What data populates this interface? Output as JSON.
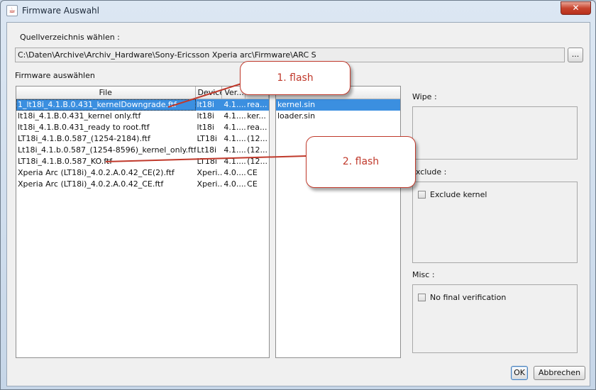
{
  "window": {
    "title": "Firmware Auswahl",
    "close_glyph": "✕",
    "app_icon": "java-icon"
  },
  "source": {
    "label": "Quellverzeichnis wählen :",
    "path": "C:\\Daten\\Archive\\Archiv_Hardware\\Sony-Ericsson Xperia arc\\Firmware\\ARC S",
    "browse_label": "..."
  },
  "firmware": {
    "label": "Firmware auswählen",
    "columns": [
      "File",
      "Device",
      "Ver...",
      "..."
    ],
    "rows": [
      {
        "file": "1_lt18i_4.1.B.0.431_kernelDowngrade.ftf",
        "device": "lt18i",
        "version": "4.1....",
        "info": "rea...",
        "selected": true
      },
      {
        "file": "lt18i_4.1.B.0.431_kernel only.ftf",
        "device": "lt18i",
        "version": "4.1....",
        "info": "ker..."
      },
      {
        "file": "lt18i_4.1.B.0.431_ready to root.ftf",
        "device": "lt18i",
        "version": "4.1....",
        "info": "rea..."
      },
      {
        "file": "LT18i_4.1.B.0.587_(1254-2184).ftf",
        "device": "LT18i",
        "version": "4.1....",
        "info": "(12..."
      },
      {
        "file": "Lt18i_4.1.b.0.587_(1254-8596)_kernel_only.ftf",
        "device": "Lt18i",
        "version": "4.1....",
        "info": "(12..."
      },
      {
        "file": "LT18i_4.1.B.0.587_KO.ftf",
        "device": "LT18i",
        "version": "4.1....",
        "info": "(12..."
      },
      {
        "file": "Xperia Arc (LT18i)_4.0.2.A.0.42_CE(2).ftf",
        "device": "Xperi...",
        "version": "4.0....",
        "info": "CE"
      },
      {
        "file": "Xperia Arc (LT18i)_4.0.2.A.0.42_CE.ftf",
        "device": "Xperi...",
        "version": "4.0....",
        "info": "CE"
      }
    ]
  },
  "content_list": {
    "items": [
      {
        "label": "kernel.sin",
        "selected": true
      },
      {
        "label": "loader.sin",
        "selected": false
      }
    ]
  },
  "wipe": {
    "label": "Wipe :"
  },
  "exclude": {
    "label": "Exclude :",
    "kernel_label": "Exclude kernel",
    "kernel_checked": false
  },
  "misc": {
    "label": "Misc :",
    "final_label": "No final verification",
    "final_checked": false
  },
  "buttons": {
    "ok": "OK",
    "cancel": "Abbrechen"
  },
  "callouts": {
    "flash1": "1. flash",
    "flash2": "2. flash"
  },
  "colors": {
    "selection": "#3b8fe0",
    "callout": "#c0392b"
  }
}
